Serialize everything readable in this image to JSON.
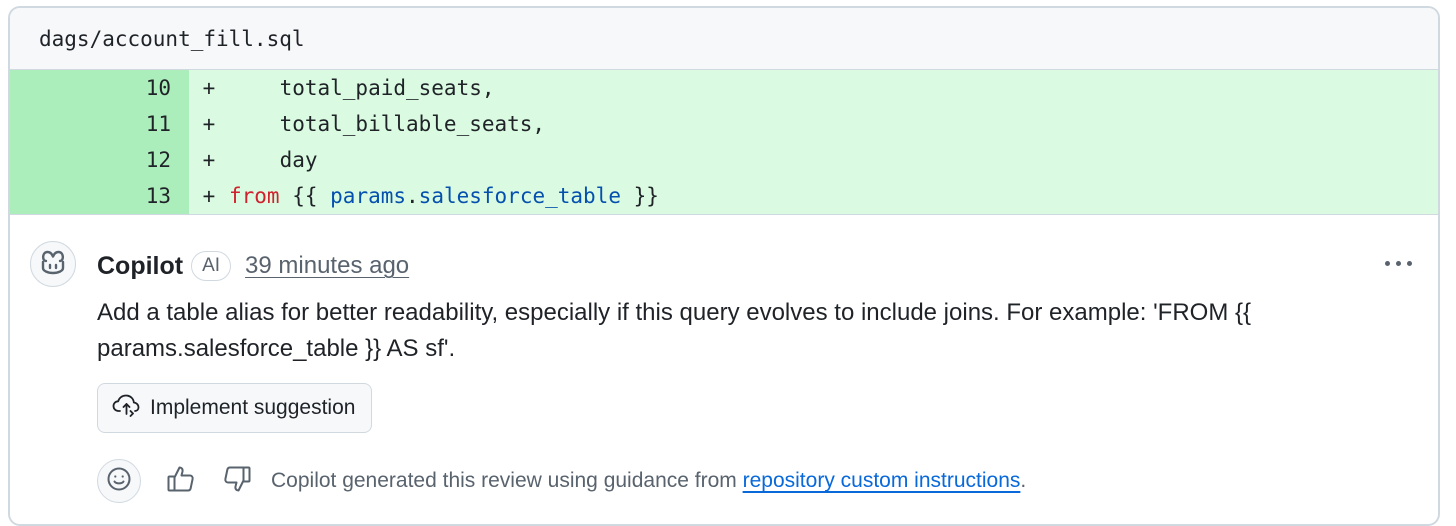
{
  "file": {
    "path": "dags/account_fill.sql"
  },
  "diff": {
    "lines": [
      {
        "number": "10",
        "marker": "+",
        "code": "    total_paid_seats,"
      },
      {
        "number": "11",
        "marker": "+",
        "code": "    total_billable_seats,"
      },
      {
        "number": "12",
        "marker": "+",
        "code": "    day"
      },
      {
        "number": "13",
        "marker": "+",
        "keyword": "from",
        "open": " {{ ",
        "obj": "params",
        "dot": ".",
        "attr": "salesforce_table",
        "close": " }}"
      }
    ]
  },
  "comment": {
    "author": "Copilot",
    "badge": "AI",
    "timestamp": "39 minutes ago",
    "body": "Add a table alias for better readability, especially if this query evolves to include joins. For example: 'FROM {{ params.salesforce_table }} AS sf'.",
    "action_label": "Implement suggestion",
    "footer_text": "Copilot generated this review using guidance from ",
    "footer_link": "repository custom instructions",
    "footer_end": "."
  },
  "icons": {
    "avatar": "copilot-icon",
    "action": "cloud-sync-icon",
    "reaction": "smiley-icon",
    "thumbs_up": "thumbs-up-icon",
    "thumbs_down": "thumbs-down-icon",
    "menu": "kebab-menu-icon"
  },
  "colors": {
    "added_bg": "#dafbe1",
    "added_gutter": "#aceebb",
    "keyword": "#cf222e",
    "name": "#0550ae",
    "link": "#0969da",
    "muted": "#59636e"
  }
}
